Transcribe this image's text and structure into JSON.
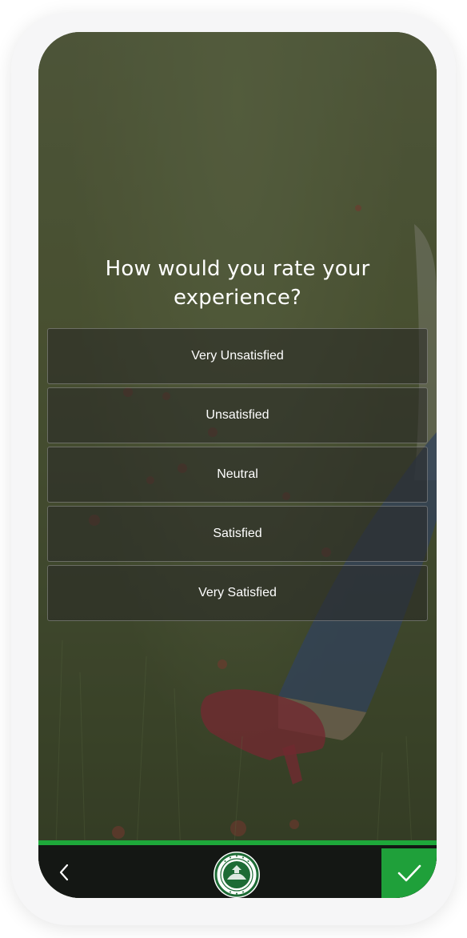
{
  "survey": {
    "question": "How would you rate your experience?",
    "options": [
      {
        "label": "Very Unsatisfied"
      },
      {
        "label": "Unsatisfied"
      },
      {
        "label": "Neutral"
      },
      {
        "label": "Satisfied"
      },
      {
        "label": "Very Satisfied"
      }
    ]
  },
  "footer": {
    "progress": 1.0,
    "back_icon": "chevron-left-icon",
    "submit_icon": "checkmark-icon",
    "logo_icon": "seal-logo-icon",
    "colors": {
      "accent_green": "#1fa03a",
      "footer_bg": "#141714"
    }
  }
}
